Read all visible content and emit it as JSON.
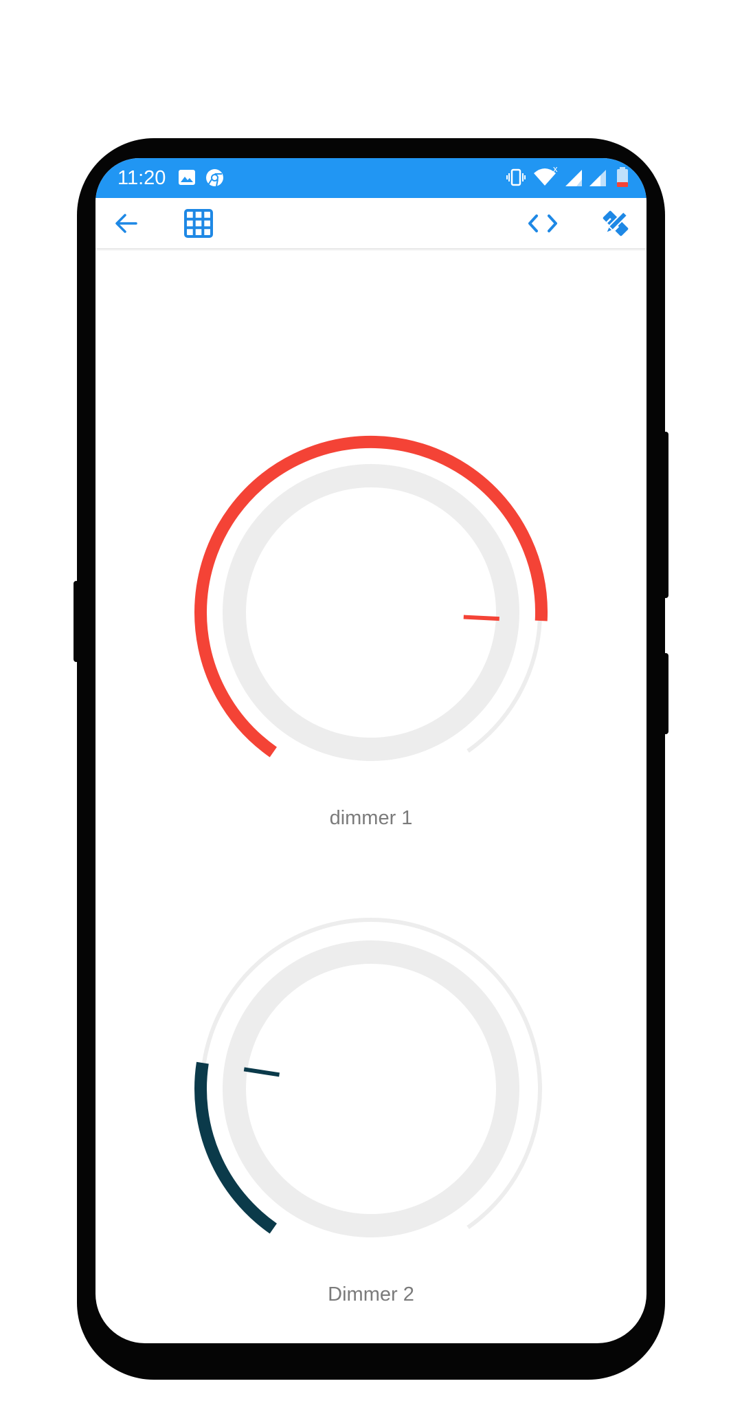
{
  "statusbar": {
    "time": "11:20",
    "icons": [
      "image-icon",
      "chrome-icon",
      "vibrate-icon",
      "wifi-icon",
      "signal-1-icon",
      "signal-2-icon",
      "battery-low-icon"
    ]
  },
  "toolbar": {
    "buttons": [
      {
        "icon": "arrow-back-icon"
      },
      {
        "icon": "grid-icon"
      },
      {
        "icon": "code-icon"
      },
      {
        "icon": "design-tools-icon"
      }
    ],
    "accent": "#1e88e5"
  },
  "dimmers": [
    {
      "label": "dimmer 1",
      "level": 0.82,
      "color": "#f44336"
    },
    {
      "label": "Dimmer 2",
      "level": 0.22,
      "color": "#0b3a4a"
    }
  ],
  "colors": {
    "statusbar": "#2196f3",
    "track": "#ededed",
    "label": "#7b7b7b"
  }
}
